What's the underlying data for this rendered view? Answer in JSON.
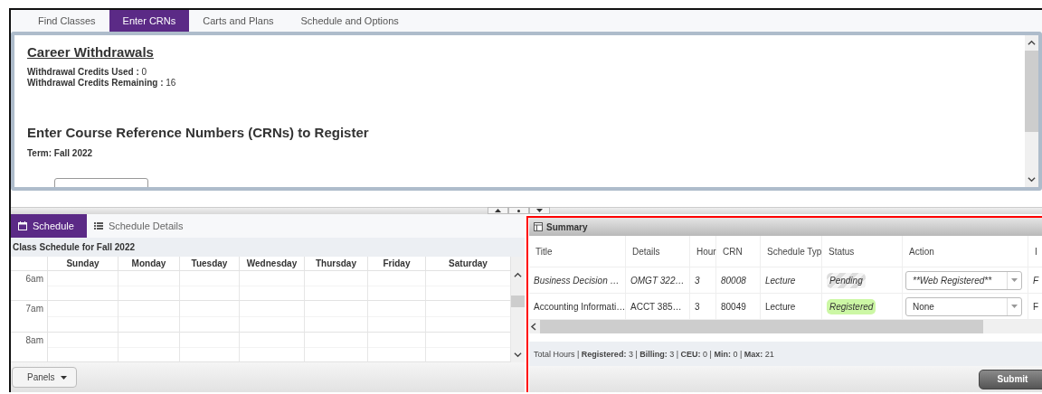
{
  "tabs": [
    {
      "label": "Find Classes",
      "selected": false
    },
    {
      "label": "Enter CRNs",
      "selected": true
    },
    {
      "label": "Carts and Plans",
      "selected": false
    },
    {
      "label": "Schedule and Options",
      "selected": false
    }
  ],
  "upper_panel": {
    "heading": "Career Withdrawals",
    "stats": [
      {
        "label": "Withdrawal Credits Used :",
        "value": "0"
      },
      {
        "label": "Withdrawal Credits Remaining :",
        "value": "16"
      }
    ],
    "title": "Enter Course Reference Numbers (CRNs) to Register",
    "term": "Term: Fall 2022"
  },
  "schedule_tabs": [
    {
      "label": "Schedule",
      "selected": true,
      "kind": "calendar"
    },
    {
      "label": "Schedule Details",
      "selected": false,
      "kind": "list"
    }
  ],
  "schedule": {
    "title": "Class Schedule for Fall 2022",
    "days": [
      "Sunday",
      "Monday",
      "Tuesday",
      "Wednesday",
      "Thursday",
      "Friday",
      "Saturday"
    ],
    "hours": [
      "6am",
      "7am",
      "8am"
    ]
  },
  "panels_button": "Panels",
  "summary": {
    "title": "Summary",
    "highlighted": true,
    "columns": [
      "Title",
      "Details",
      "Hour",
      "CRN",
      "Schedule Typ",
      "Status",
      "Action",
      "I"
    ],
    "rows": [
      {
        "title": "Business Decision …",
        "details": "OMGT 322…",
        "hours": "3",
        "crn": "80008",
        "schedule_type": "Lecture",
        "status": "Pending",
        "kind": "pending",
        "action": "**Web Registered**",
        "column_8": "F"
      },
      {
        "title": "Accounting Informati…",
        "details": "ACCT 385…",
        "hours": "3",
        "crn": "80049",
        "schedule_type": "Lecture",
        "status": "Registered",
        "kind": "registered",
        "action": "None",
        "column_8": "F"
      }
    ],
    "totals": "Total Hours | **Registered:** 3 | **Billing:** 3 | **CEU:** 0 | **Min:** 0 | **Max:** 21",
    "submit": "Submit"
  }
}
